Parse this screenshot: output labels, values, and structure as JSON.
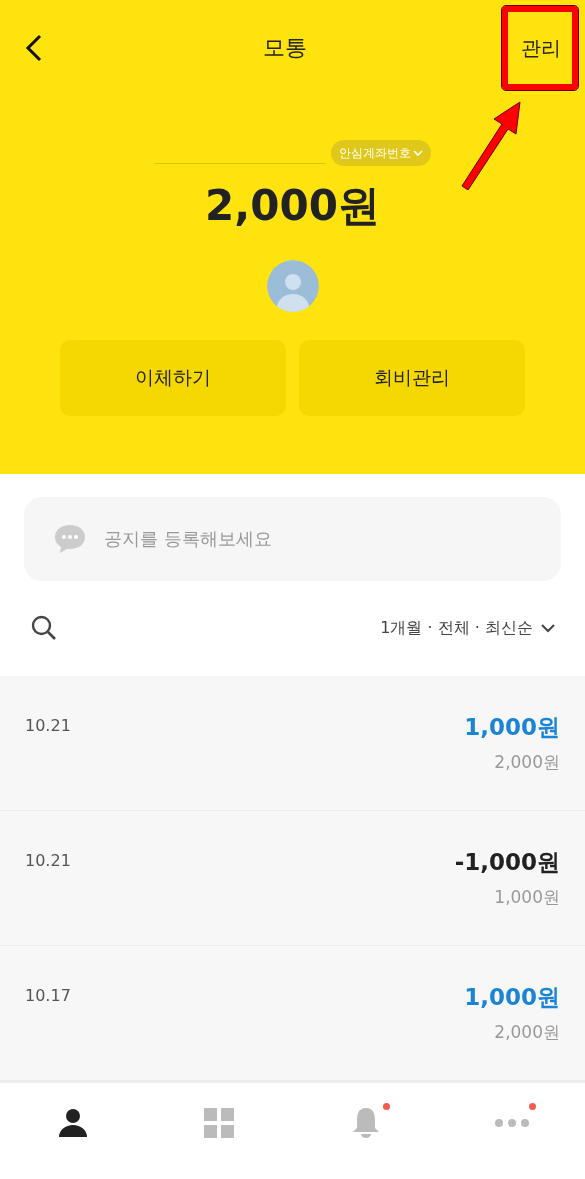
{
  "header": {
    "title": "모통",
    "action": "관리"
  },
  "account": {
    "number_label": "안심계좌번호",
    "balance": "2,000원"
  },
  "actions": [
    "이체하기",
    "회비관리"
  ],
  "notice": {
    "placeholder": "공지를 등록해보세요"
  },
  "filter": {
    "label": "1개월 · 전체 · 최신순"
  },
  "transactions": [
    {
      "date": "10.21",
      "amount": "1,000원",
      "balance": "2,000원",
      "kind": "deposit"
    },
    {
      "date": "10.21",
      "amount": "-1,000원",
      "balance": "1,000원",
      "kind": "withdrawal"
    },
    {
      "date": "10.17",
      "amount": "1,000원",
      "balance": "2,000원",
      "kind": "deposit"
    }
  ],
  "tabs": [
    {
      "kind": "profile",
      "selected": true,
      "badge": false
    },
    {
      "kind": "grid",
      "selected": false,
      "badge": false
    },
    {
      "kind": "bell",
      "selected": false,
      "badge": true
    },
    {
      "kind": "more",
      "selected": false,
      "badge": true
    }
  ],
  "annotation": {
    "highlighted": true
  }
}
